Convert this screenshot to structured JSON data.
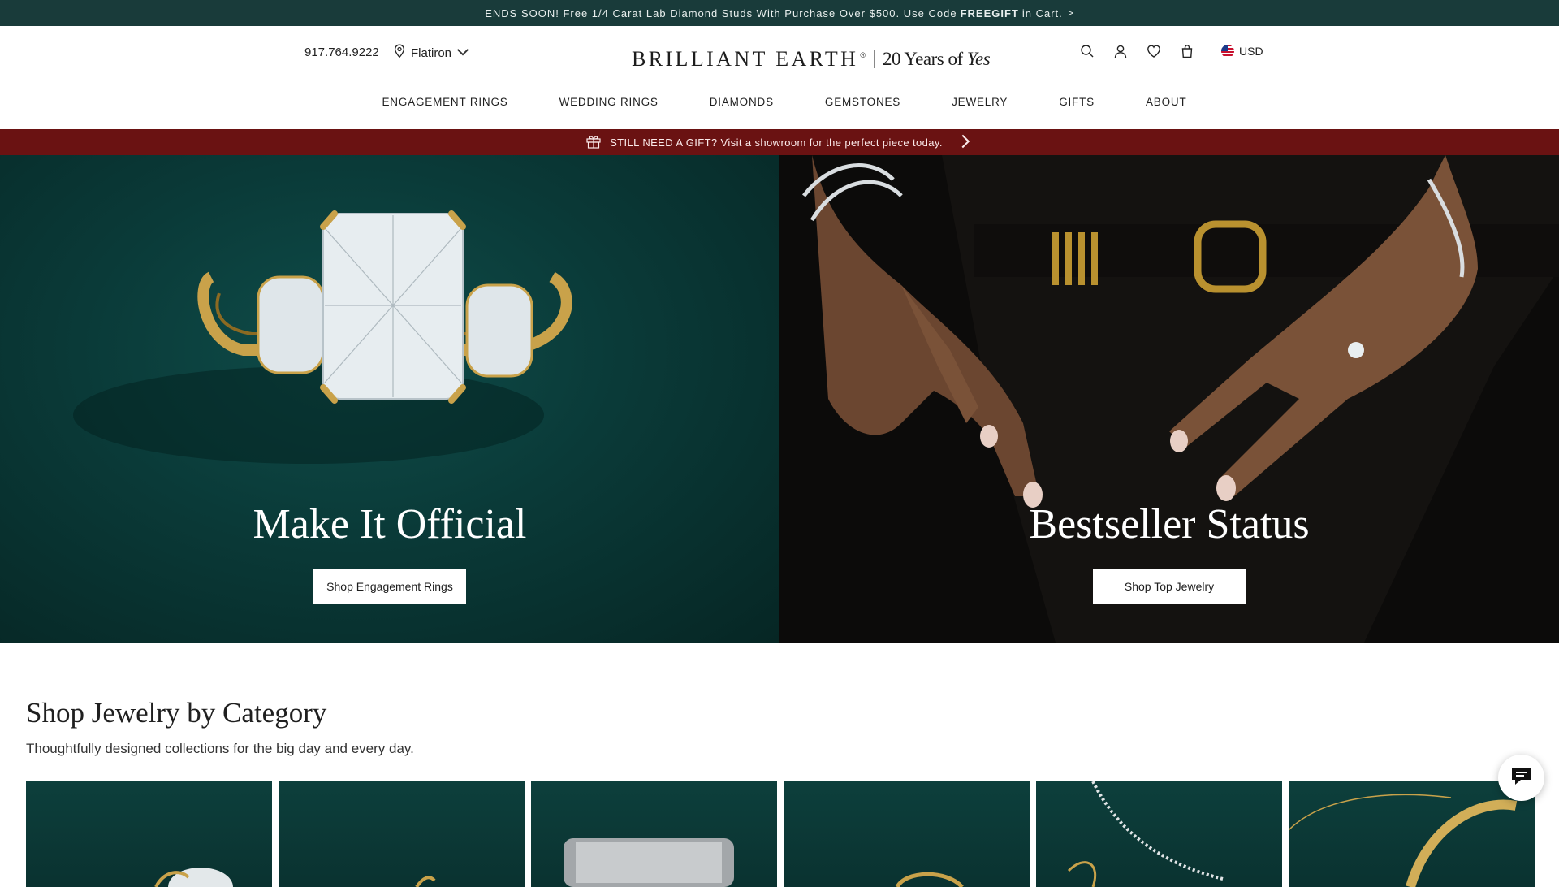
{
  "promo_top": {
    "text_before": "ENDS SOON! Free 1/4 Carat Lab Diamond Studs With Purchase Over $500. Use Code",
    "code": "FREEGIFT",
    "text_after": "in Cart.",
    "chevron": ">"
  },
  "header": {
    "phone": "917.764.9222",
    "store": "Flatiron",
    "logo": {
      "brand": "BRILLIANT EARTH",
      "reg": "®",
      "tag_prefix": "20 Years of",
      "tag_word": "Yes"
    },
    "currency": "USD",
    "icons": [
      "search-icon",
      "account-icon",
      "wishlist-icon",
      "bag-icon"
    ]
  },
  "nav": [
    "ENGAGEMENT RINGS",
    "WEDDING RINGS",
    "DIAMONDS",
    "GEMSTONES",
    "JEWELRY",
    "GIFTS",
    "ABOUT"
  ],
  "announce": {
    "text": "STILL NEED A GIFT? Visit a showroom for the perfect piece today."
  },
  "hero": {
    "left": {
      "title": "Make It Official",
      "button": "Shop Engagement Rings"
    },
    "right": {
      "title": "Bestseller Status",
      "button": "Shop Top Jewelry"
    }
  },
  "category": {
    "title": "Shop Jewelry by Category",
    "subtitle": "Thoughtfully designed collections for the big day and every day.",
    "tiles": 6
  },
  "colors": {
    "promo_bg": "#193b3a",
    "announce_bg": "#6a1212",
    "hero_green": "#0a3a38"
  }
}
